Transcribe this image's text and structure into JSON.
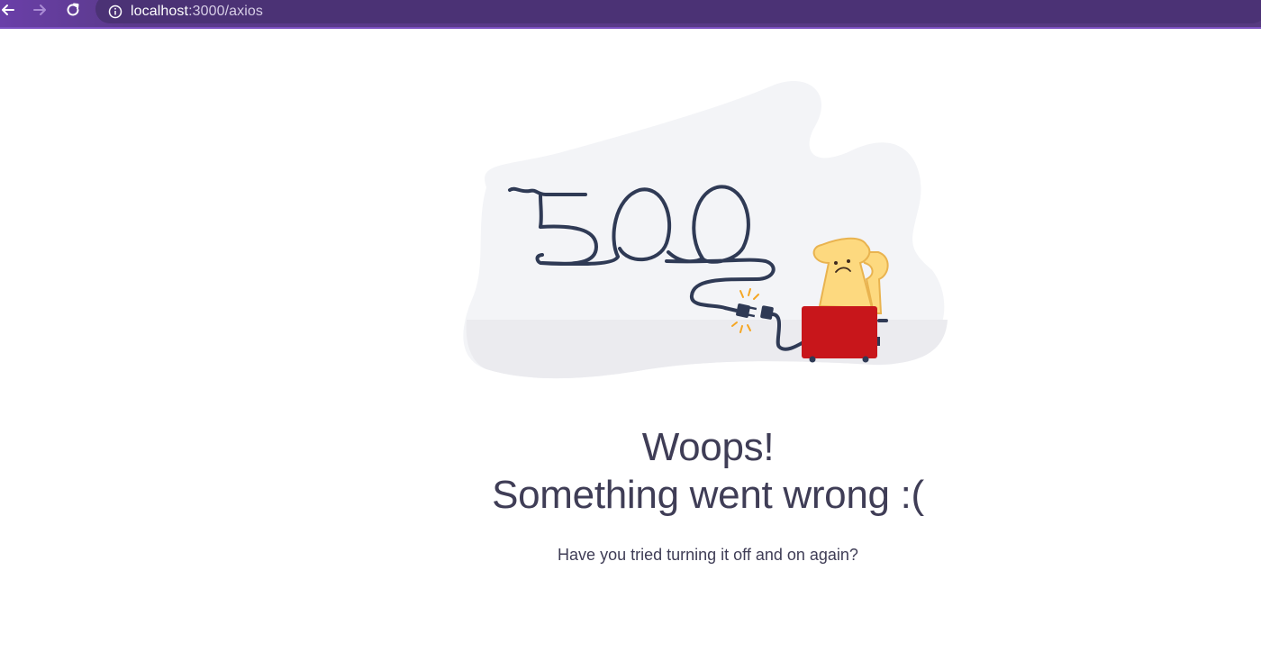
{
  "browser": {
    "url_host": "localhost",
    "url_path": ":3000/axios",
    "icons": [
      "back-arrow-icon",
      "forward-arrow-icon",
      "reload-icon",
      "info-icon"
    ]
  },
  "error": {
    "code": "500",
    "title_line1": "Woops!",
    "title_line2": "Something went wrong :(",
    "message": "Have you tried turning it off and on again?"
  },
  "colors": {
    "browser_bar": "#5b3a8c",
    "text": "#3f3d56",
    "toaster": "#c8161b",
    "toast": "#fdd97f",
    "cable": "#2f3a55",
    "blob": "#f3f4f7"
  }
}
